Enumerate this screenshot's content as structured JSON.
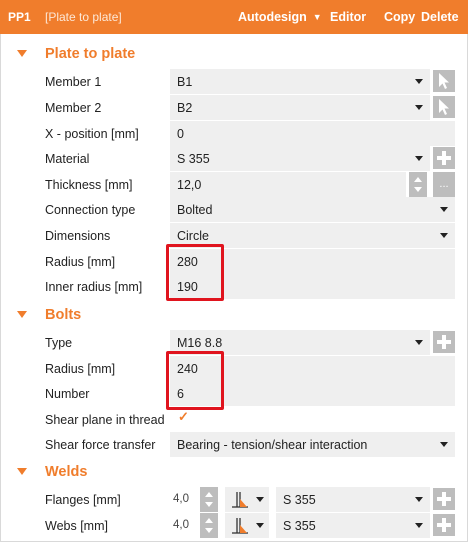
{
  "header": {
    "id": "PP1",
    "name": "[Plate to plate]",
    "autodesign": "Autodesign",
    "editor": "Editor",
    "copy": "Copy",
    "delete": "Delete"
  },
  "plate": {
    "title": "Plate to plate",
    "member1": {
      "label": "Member 1",
      "value": "B1"
    },
    "member2": {
      "label": "Member 2",
      "value": "B2"
    },
    "xpos": {
      "label": "X - position [mm]",
      "value": "0"
    },
    "material": {
      "label": "Material",
      "value": "S 355"
    },
    "thickness": {
      "label": "Thickness [mm]",
      "value": "12,0",
      "more": "..."
    },
    "conntype": {
      "label": "Connection type",
      "value": "Bolted"
    },
    "dimensions": {
      "label": "Dimensions",
      "value": "Circle"
    },
    "radius": {
      "label": "Radius [mm]",
      "value": "280"
    },
    "inner_radius": {
      "label": "Inner radius [mm]",
      "value": "190"
    }
  },
  "bolts": {
    "title": "Bolts",
    "type": {
      "label": "Type",
      "value": "M16 8.8"
    },
    "radius": {
      "label": "Radius [mm]",
      "value": "240"
    },
    "number": {
      "label": "Number",
      "value": "6"
    },
    "shear_plane": {
      "label": "Shear plane in thread",
      "checked": true
    },
    "shear_force": {
      "label": "Shear force transfer",
      "value": "Bearing - tension/shear interaction"
    }
  },
  "welds": {
    "title": "Welds",
    "flanges": {
      "label": "Flanges [mm]",
      "size": "4,0",
      "material": "S 355"
    },
    "webs": {
      "label": "Webs [mm]",
      "size": "4,0",
      "material": "S 355"
    }
  },
  "colors": {
    "accent": "#f07d2c",
    "highlight": "#e0141e",
    "field_bg": "#efefef",
    "button_bg": "#bdbdbd"
  }
}
